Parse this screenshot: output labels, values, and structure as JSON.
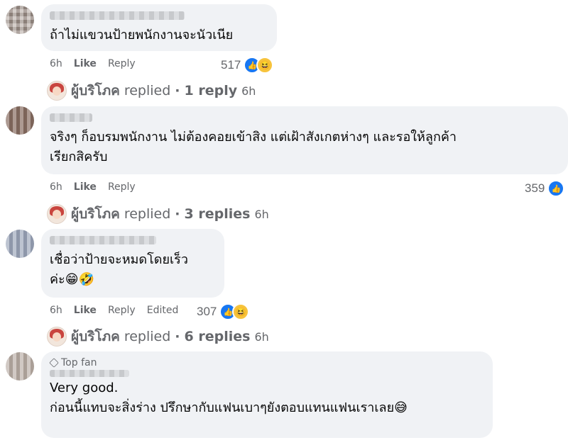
{
  "page_name": "ผู้บริโภค",
  "comments": [
    {
      "text": "ถ้าไม่แขวนป้ายพนักงานจะนัวเนีย",
      "time": "6h",
      "like_label": "Like",
      "reply_label": "Reply",
      "reaction_count": "517",
      "replies": {
        "replied_label": "replied",
        "count_label": "1 reply",
        "time": "6h"
      }
    },
    {
      "text": "จริงๆ ก็อบรมพนักงาน ไม่ต้องคอยเข้าสิง แต่เฝ้าสังเกตห่างๆ และรอให้ลูกค้า\nเรียกสิครับ",
      "time": "6h",
      "like_label": "Like",
      "reply_label": "Reply",
      "reaction_count": "359",
      "replies": {
        "replied_label": "replied",
        "count_label": "3 replies",
        "time": "6h"
      }
    },
    {
      "text": "เชื่อว่าป้ายจะหมดโดยเร็ว\nค่ะ😁🤣",
      "time": "6h",
      "like_label": "Like",
      "reply_label": "Reply",
      "edited_label": "Edited",
      "reaction_count": "307",
      "replies": {
        "replied_label": "replied",
        "count_label": "6 replies",
        "time": "6h"
      }
    },
    {
      "badge": "Top fan",
      "text": "Very good.\nก่อนนี้แทบจะสิ่งร่าง ปรึกษากับแฟนเบาๆยังตอบแทนแฟนเราเลย😅"
    }
  ],
  "colors": {
    "bubble": "#f0f2f5",
    "meta": "#65676b",
    "like": "#1877f2",
    "haha": "#f7c33c"
  }
}
